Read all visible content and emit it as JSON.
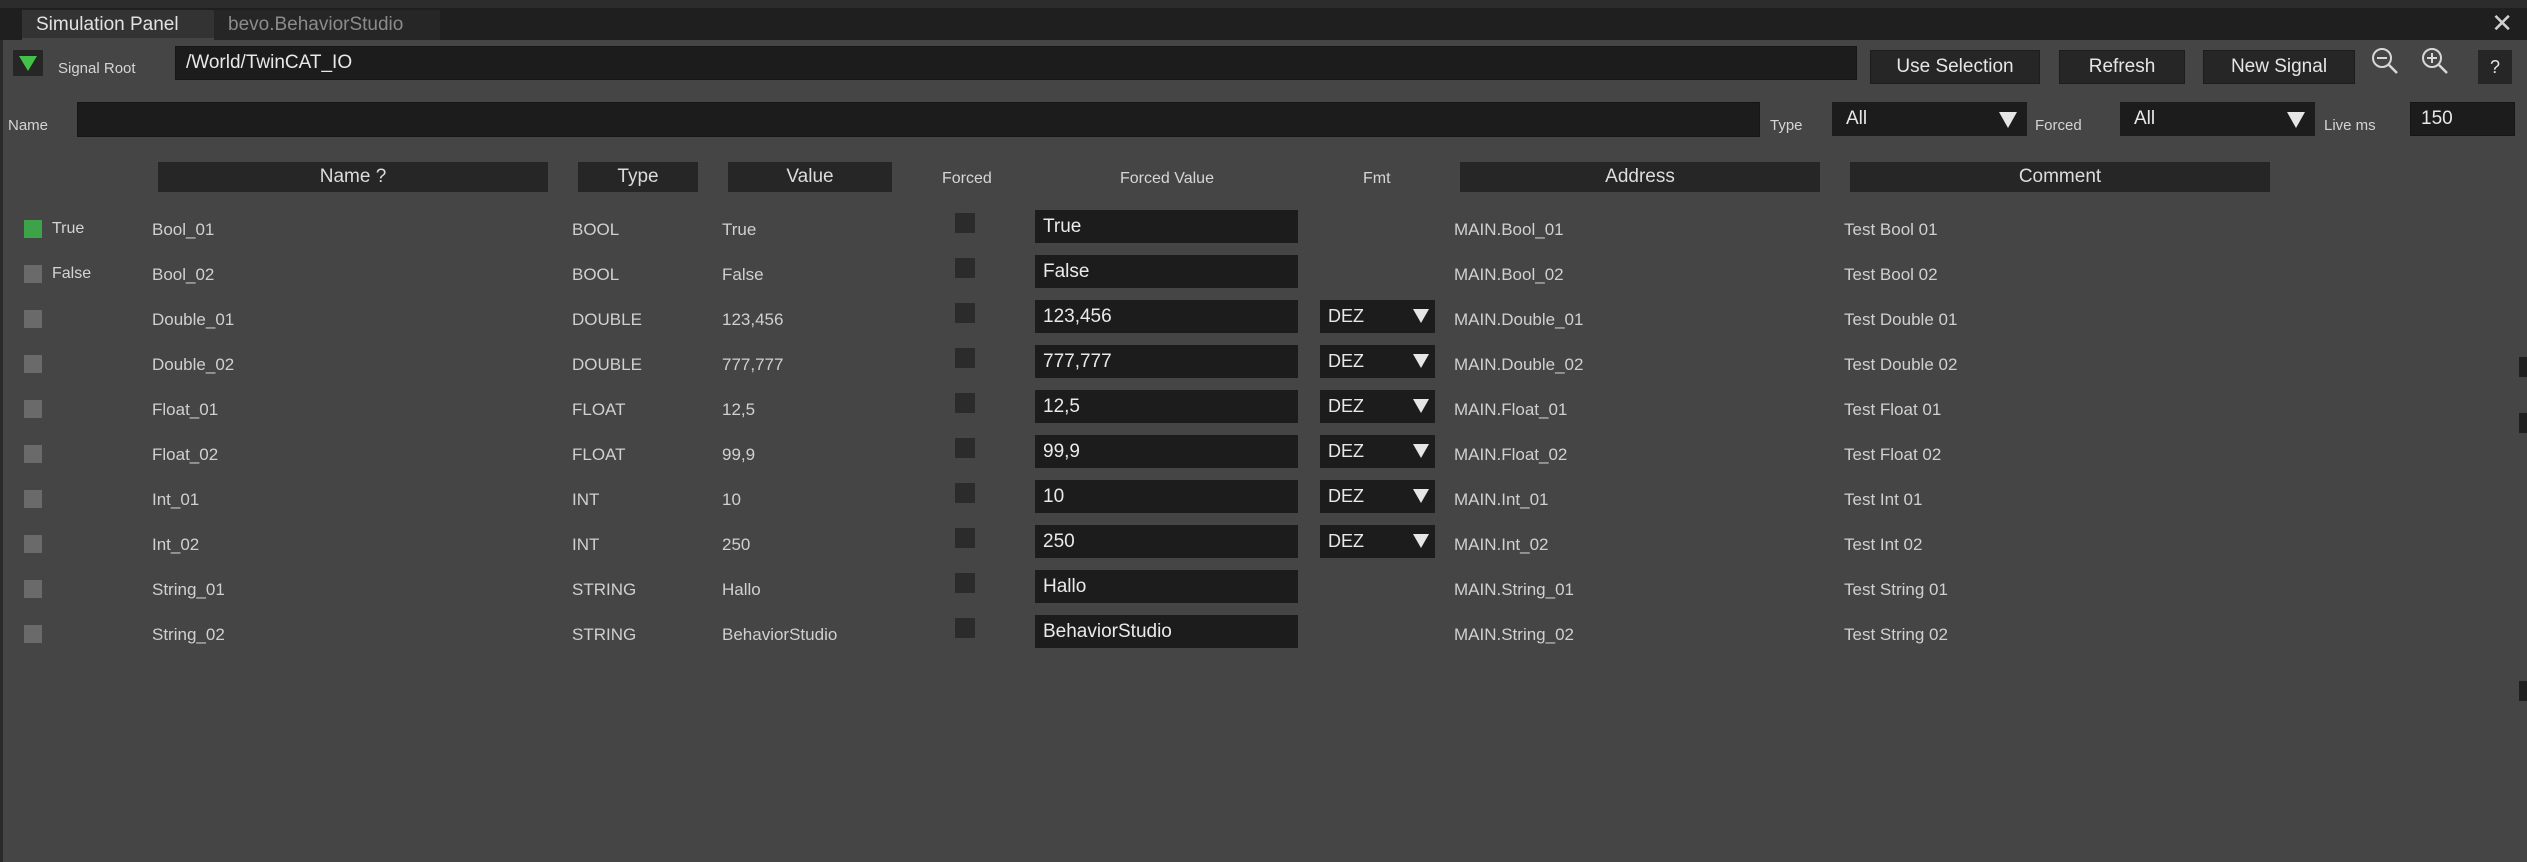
{
  "tabs": [
    {
      "label": "Simulation Panel"
    },
    {
      "label": "bevo.BehaviorStudio"
    }
  ],
  "window": {
    "close_glyph": "✕"
  },
  "toolbar": {
    "signal_root_label": "Signal Root",
    "signal_root_value": "/World/TwinCAT_IO",
    "use_selection_label": "Use Selection",
    "refresh_label": "Refresh",
    "new_signal_label": "New Signal",
    "help_label": "?",
    "zoom_out_icon": "zoom-out-icon",
    "zoom_in_icon": "zoom-in-icon",
    "toggle_icon": "triangle-down-icon",
    "accent_color": "#43c24a"
  },
  "filters": {
    "name_label": "Name",
    "name_value": "",
    "type_label": "Type",
    "type_value": "All",
    "forced_label": "Forced",
    "forced_value": "All",
    "live_ms_label": "Live ms",
    "live_ms_value": "150"
  },
  "columns": {
    "name": "Name ?",
    "type": "Type",
    "value": "Value",
    "forced": "Forced",
    "forced_value": "Forced Value",
    "fmt": "Fmt",
    "address": "Address",
    "comment": "Comment"
  },
  "rows": [
    {
      "live": "True",
      "live_on": true,
      "name": "Bool_01",
      "type": "BOOL",
      "value": "True",
      "forced": false,
      "forced_value": "True",
      "fmt": "",
      "address": "MAIN.Bool_01",
      "comment": "Test Bool 01"
    },
    {
      "live": "False",
      "live_on": false,
      "name": "Bool_02",
      "type": "BOOL",
      "value": "False",
      "forced": false,
      "forced_value": "False",
      "fmt": "",
      "address": "MAIN.Bool_02",
      "comment": "Test Bool 02"
    },
    {
      "live": "",
      "live_on": false,
      "name": "Double_01",
      "type": "DOUBLE",
      "value": "123,456",
      "forced": false,
      "forced_value": "123,456",
      "fmt": "DEZ",
      "address": "MAIN.Double_01",
      "comment": "Test Double 01"
    },
    {
      "live": "",
      "live_on": false,
      "name": "Double_02",
      "type": "DOUBLE",
      "value": "777,777",
      "forced": false,
      "forced_value": "777,777",
      "fmt": "DEZ",
      "address": "MAIN.Double_02",
      "comment": "Test Double 02"
    },
    {
      "live": "",
      "live_on": false,
      "name": "Float_01",
      "type": "FLOAT",
      "value": "12,5",
      "forced": false,
      "forced_value": "12,5",
      "fmt": "DEZ",
      "address": "MAIN.Float_01",
      "comment": "Test Float 01"
    },
    {
      "live": "",
      "live_on": false,
      "name": "Float_02",
      "type": "FLOAT",
      "value": "99,9",
      "forced": false,
      "forced_value": "99,9",
      "fmt": "DEZ",
      "address": "MAIN.Float_02",
      "comment": "Test Float 02"
    },
    {
      "live": "",
      "live_on": false,
      "name": "Int_01",
      "type": "INT",
      "value": "10",
      "forced": false,
      "forced_value": "10",
      "fmt": "DEZ",
      "address": "MAIN.Int_01",
      "comment": "Test Int 01"
    },
    {
      "live": "",
      "live_on": false,
      "name": "Int_02",
      "type": "INT",
      "value": "250",
      "forced": false,
      "forced_value": "250",
      "fmt": "DEZ",
      "address": "MAIN.Int_02",
      "comment": "Test Int 02"
    },
    {
      "live": "",
      "live_on": false,
      "name": "String_01",
      "type": "STRING",
      "value": "Hallo",
      "forced": false,
      "forced_value": "Hallo",
      "fmt": "",
      "address": "MAIN.String_01",
      "comment": "Test String 01"
    },
    {
      "live": "",
      "live_on": false,
      "name": "String_02",
      "type": "STRING",
      "value": "BehaviorStudio",
      "forced": false,
      "forced_value": "BehaviorStudio",
      "fmt": "",
      "address": "MAIN.String_02",
      "comment": "Test String 02"
    }
  ]
}
